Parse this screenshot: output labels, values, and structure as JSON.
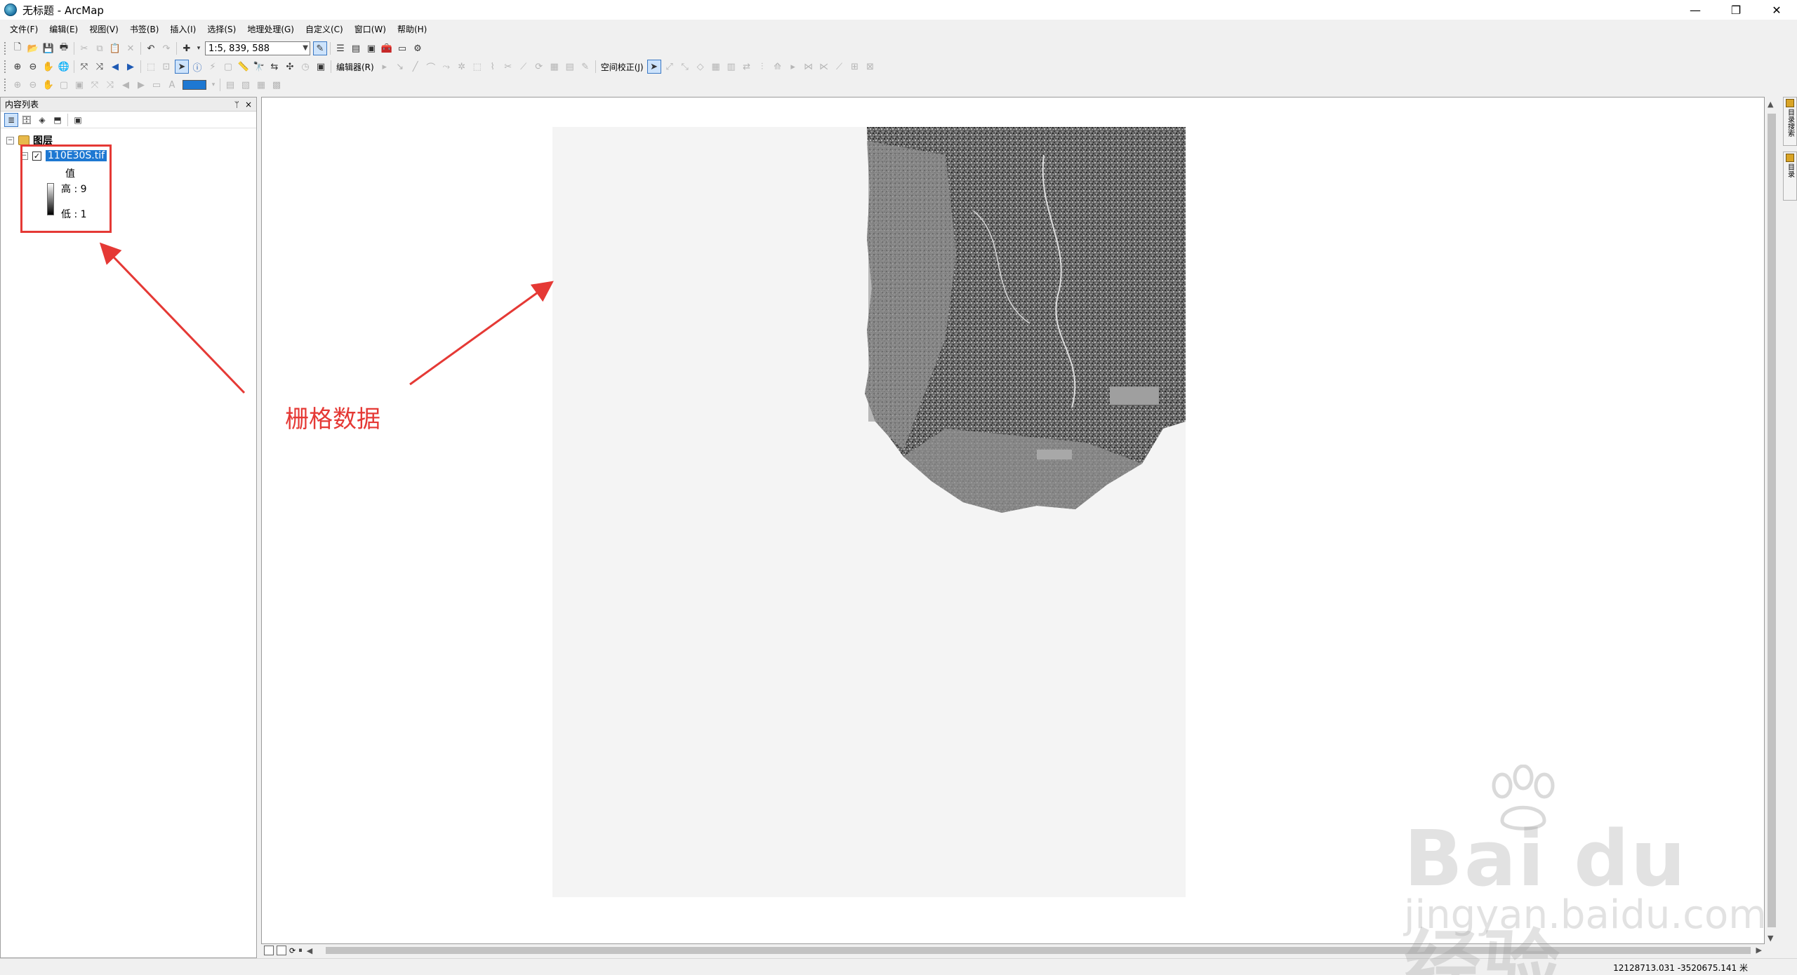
{
  "window": {
    "title": "无标题 - ArcMap",
    "minimize": "—",
    "restore": "❐",
    "close": "✕"
  },
  "menu": [
    "文件(F)",
    "编辑(E)",
    "视图(V)",
    "书签(B)",
    "插入(I)",
    "选择(S)",
    "地理处理(G)",
    "自定义(C)",
    "窗口(W)",
    "帮助(H)"
  ],
  "toolbar": {
    "scale": "1:5, 839, 588",
    "editor_label": "编辑器(R)",
    "georef_label": "空间校正(J)"
  },
  "toc": {
    "title": "内容列表",
    "pin": "ᛘ",
    "close": "×",
    "group_label": "图层",
    "layer_name": "110E30S.tif",
    "legend_field": "值",
    "legend_high": "高 : 9",
    "legend_low": "低 : 1"
  },
  "annotation": {
    "text": "栅格数据",
    "color": "#e53935"
  },
  "status": {
    "coordinates": "12128713.031  -3520675.141 米"
  },
  "right_dock": {
    "tab1": "目录搜索",
    "tab2": "目录"
  },
  "watermark": {
    "main": "Bai du经验",
    "sub": "jingyan.baidu.com"
  },
  "colors": {
    "selection_blue": "#1e78d2",
    "annotation_red": "#e53935",
    "map_background": "#f4f4f4"
  }
}
